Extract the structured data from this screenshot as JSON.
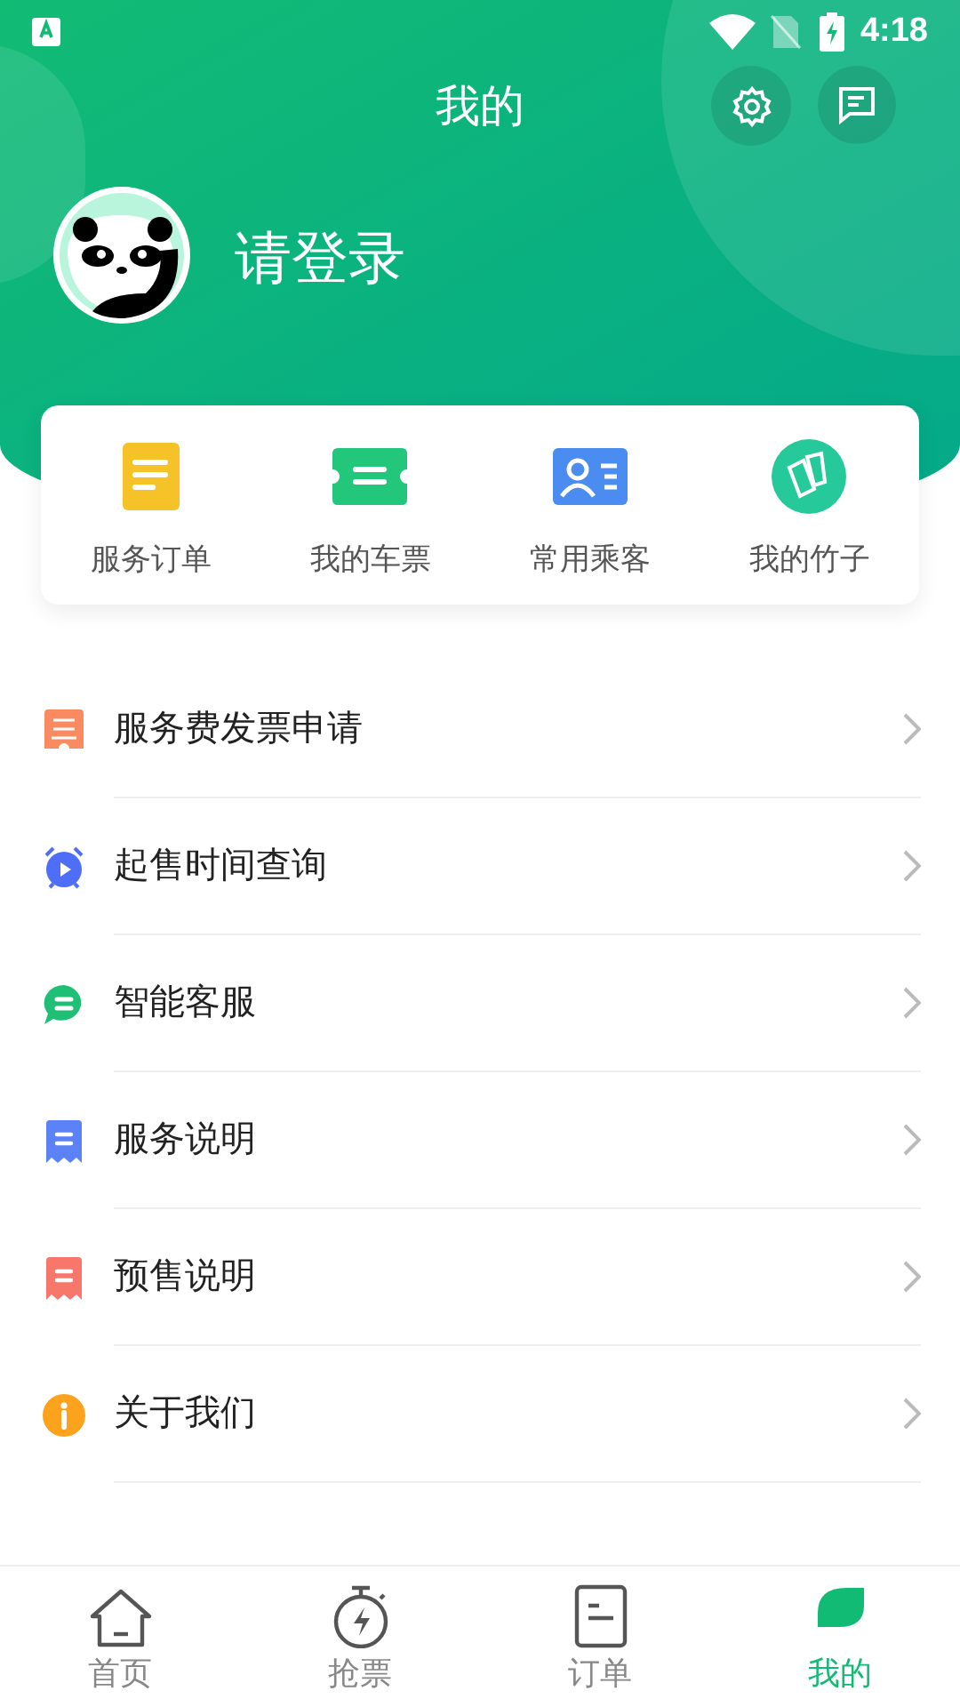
{
  "status_bar": {
    "time": "4:18"
  },
  "header": {
    "title": "我的",
    "login": "请登录"
  },
  "shortcuts": [
    {
      "kind": "order",
      "label": "服务订单"
    },
    {
      "kind": "ticket",
      "label": "我的车票"
    },
    {
      "kind": "passenger",
      "label": "常用乘客"
    },
    {
      "kind": "bamboo",
      "label": "我的竹子"
    }
  ],
  "menu": [
    {
      "kind": "invoice",
      "color": "#fa8a60",
      "label": "服务费发票申请"
    },
    {
      "kind": "alarm",
      "color": "#4f6ef7",
      "label": "起售时间查询"
    },
    {
      "kind": "chat",
      "color": "#1fbf75",
      "label": "智能客服"
    },
    {
      "kind": "doc",
      "color": "#5b82f7",
      "label": "服务说明"
    },
    {
      "kind": "doc",
      "color": "#f7776a",
      "label": "预售说明"
    },
    {
      "kind": "info",
      "color": "#fca21c",
      "label": "关于我们"
    }
  ],
  "tabs": [
    {
      "kind": "home",
      "label": "首页",
      "selected": false
    },
    {
      "kind": "grab",
      "label": "抢票",
      "selected": false
    },
    {
      "kind": "orders",
      "label": "订单",
      "selected": false
    },
    {
      "kind": "me",
      "label": "我的",
      "selected": true
    }
  ]
}
